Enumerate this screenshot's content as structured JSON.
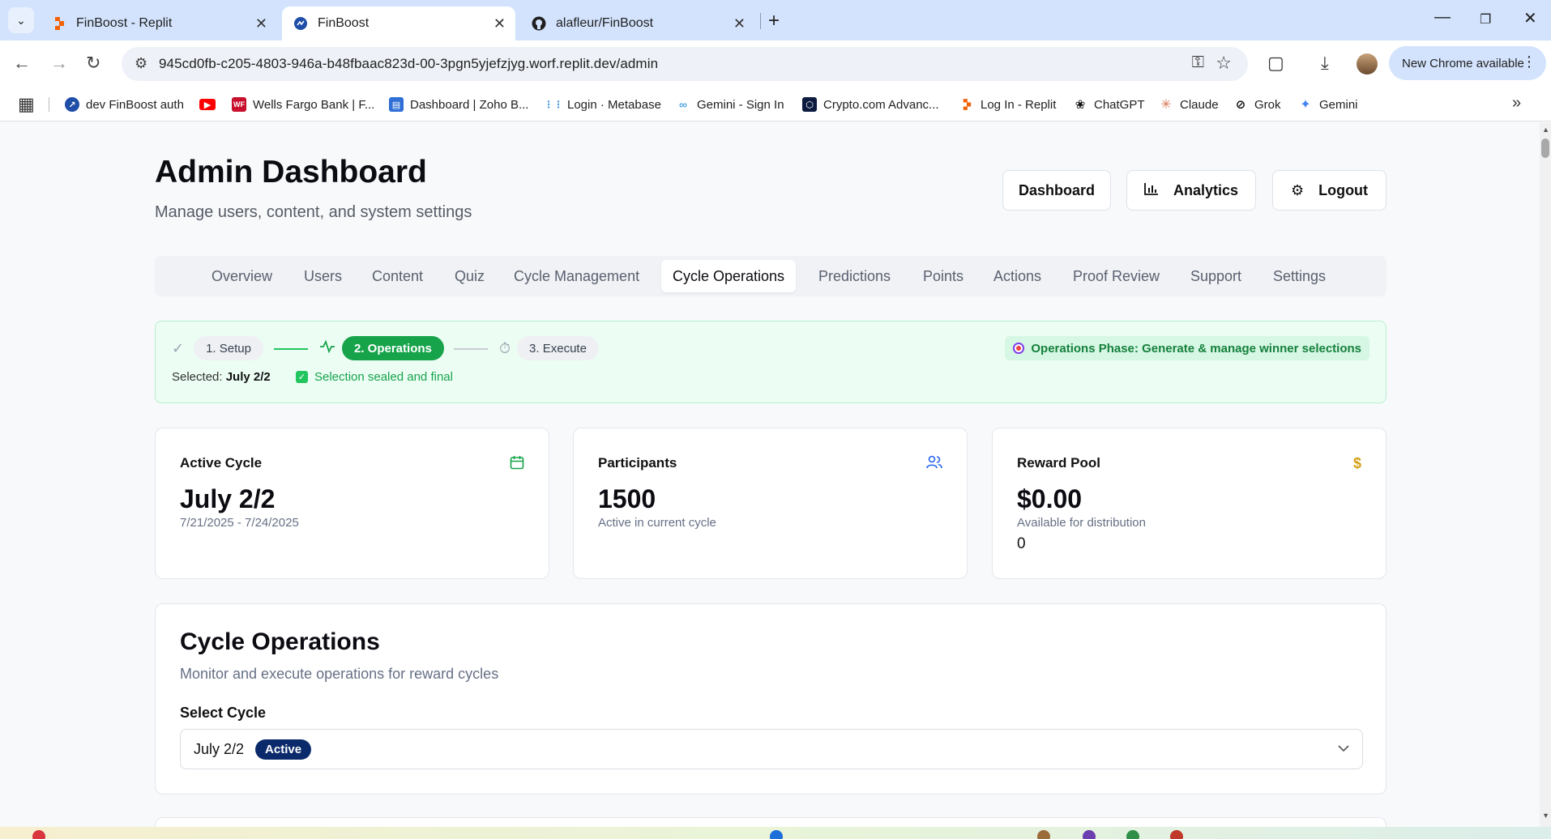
{
  "browser": {
    "tabs": [
      {
        "title": "FinBoost - Replit",
        "active": false
      },
      {
        "title": "FinBoost",
        "active": true
      },
      {
        "title": "alafleur/FinBoost",
        "active": false
      }
    ],
    "url": "945cd0fb-c205-4803-946a-b48fbaac823d-00-3pgn5yjefzjyg.worf.replit.dev/admin",
    "new_chrome_label": "New Chrome available",
    "bookmarks": [
      "dev FinBoost auth",
      "",
      "Wells Fargo Bank | F...",
      "Dashboard | Zoho B...",
      "Login · Metabase",
      "Gemini - Sign In",
      "Crypto.com Advanc...",
      "Log In - Replit",
      "ChatGPT",
      "Claude",
      "Grok",
      "Gemini"
    ]
  },
  "header": {
    "title": "Admin Dashboard",
    "subtitle": "Manage users, content, and system settings",
    "buttons": {
      "dashboard": "Dashboard",
      "analytics": "Analytics",
      "logout": "Logout"
    }
  },
  "nav_tabs": [
    "Overview",
    "Users",
    "Content",
    "Quiz",
    "Cycle Management",
    "Cycle Operations",
    "Predictions",
    "Points",
    "Actions",
    "Proof Review",
    "Support",
    "Settings"
  ],
  "active_tab": "Cycle Operations",
  "phase": {
    "steps": [
      "1. Setup",
      "2. Operations",
      "3. Execute"
    ],
    "current_step": 2,
    "selected_label": "Selected:",
    "selected_value": "July 2/2",
    "sealed_text": "Selection sealed and final",
    "badge": "Operations Phase: Generate & manage winner selections"
  },
  "cards": {
    "active_cycle": {
      "title": "Active Cycle",
      "value": "July 2/2",
      "sub": "7/21/2025 - 7/24/2025"
    },
    "participants": {
      "title": "Participants",
      "value": "1500",
      "sub": "Active in current cycle"
    },
    "reward_pool": {
      "title": "Reward Pool",
      "value": "$0.00",
      "sub": "Available for distribution",
      "extra": "0"
    }
  },
  "cycle_operations": {
    "title": "Cycle Operations",
    "subtitle": "Monitor and execute operations for reward cycles",
    "select_label": "Select Cycle",
    "selected_cycle": "July 2/2",
    "status_badge": "Active"
  },
  "colors": {
    "accent_green": "#16a34a",
    "phase_bg": "#ecfdf4",
    "badge_navy": "#0b2a6b",
    "chrome_tab_bg": "#d3e3fd"
  }
}
